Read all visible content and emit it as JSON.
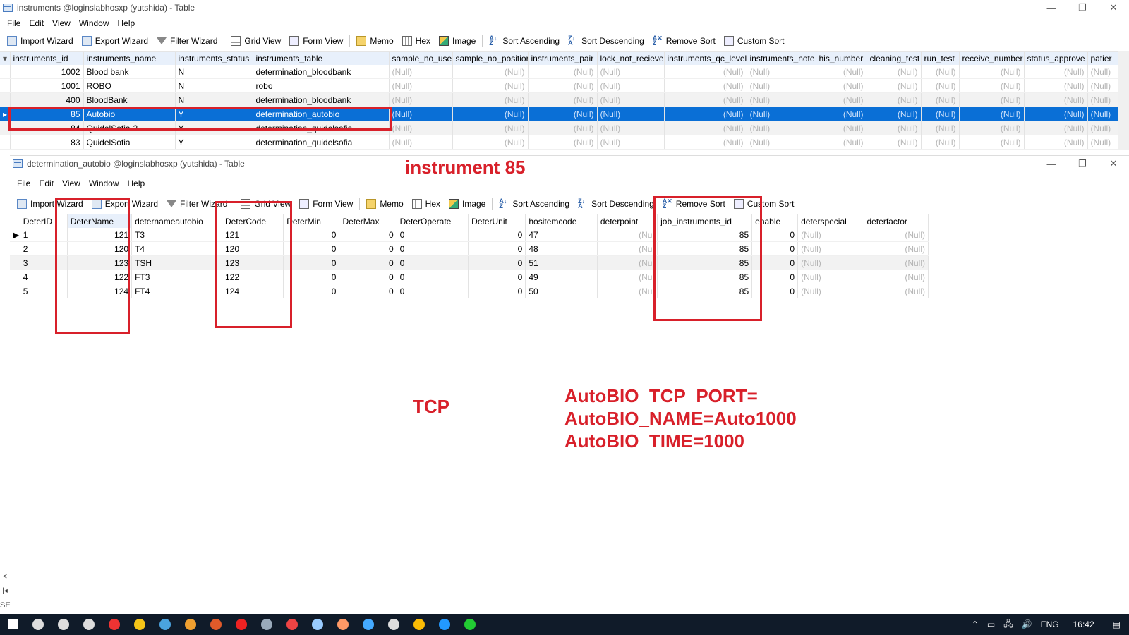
{
  "top_window": {
    "title": "instruments @loginslabhosxp (yutshida) - Table",
    "controls": [
      "—",
      "❐",
      "✕"
    ],
    "menu": [
      "File",
      "Edit",
      "View",
      "Window",
      "Help"
    ],
    "toolbar": {
      "import_wizard": "Import Wizard",
      "export_wizard": "Export Wizard",
      "filter_wizard": "Filter Wizard",
      "grid_view": "Grid View",
      "form_view": "Form View",
      "memo": "Memo",
      "hex": "Hex",
      "image": "Image",
      "sort_asc": "Sort Ascending",
      "sort_desc": "Sort Descending",
      "remove_sort": "Remove Sort",
      "custom_sort": "Custom Sort"
    },
    "columns": [
      "instruments_id",
      "instruments_name",
      "instruments_status",
      "instruments_table",
      "sample_no_use",
      "sample_no_positior",
      "instruments_pair",
      "lock_not_recieve",
      "instruments_qc_level",
      "instruments_note",
      "his_number",
      "cleaning_test",
      "run_test",
      "receive_number",
      "status_approve",
      "patier"
    ],
    "rows": [
      [
        "1002",
        "Blood bank",
        "N",
        "determination_bloodbank"
      ],
      [
        "1001",
        "ROBO",
        "N",
        "robo"
      ],
      [
        "400",
        "BloodBank",
        "N",
        "determination_bloodbank"
      ],
      [
        "85",
        "Autobio",
        "Y",
        "determination_autobio"
      ],
      [
        "84",
        "QuidelSofia-2",
        "Y",
        "determination_quidelsofia"
      ],
      [
        "83",
        "QuidelSofia",
        "Y",
        "determination_quidelsofia"
      ]
    ],
    "null_text": "(Null)"
  },
  "bottom_window": {
    "title": "determination_autobio @loginslabhosxp (yutshida) - Table",
    "controls": [
      "—",
      "❐",
      "✕"
    ],
    "menu": [
      "File",
      "Edit",
      "View",
      "Window",
      "Help"
    ],
    "toolbar": {
      "import_wizard": "Import Wizard",
      "export_wizard": "Export Wizard",
      "filter_wizard": "Filter Wizard",
      "grid_view": "Grid View",
      "form_view": "Form View",
      "memo": "Memo",
      "hex": "Hex",
      "image": "Image",
      "sort_asc": "Sort Ascending",
      "sort_desc": "Sort Descending",
      "remove_sort": "Remove Sort",
      "custom_sort": "Custom Sort"
    },
    "columns": [
      "DeterID",
      "DeterName",
      "deternameautobio",
      "DeterCode",
      "DeterMin",
      "DeterMax",
      "DeterOperate",
      "DeterUnit",
      "hositemcode",
      "deterpoint",
      "job_instruments_id",
      "enable",
      "deterspecial",
      "deterfactor"
    ],
    "rows": [
      [
        "1",
        "121",
        "T3",
        "121",
        "0",
        "0",
        "0",
        "0",
        "47",
        "(Nul",
        "85",
        "0",
        "(Null)",
        "(Null)"
      ],
      [
        "2",
        "120",
        "T4",
        "120",
        "0",
        "0",
        "0",
        "0",
        "48",
        "(Nul",
        "85",
        "0",
        "(Null)",
        "(Null)"
      ],
      [
        "3",
        "123",
        "TSH",
        "123",
        "0",
        "0",
        "0",
        "0",
        "51",
        "(Nul",
        "85",
        "0",
        "(Null)",
        "(Null)"
      ],
      [
        "4",
        "122",
        "FT3",
        "122",
        "0",
        "0",
        "0",
        "0",
        "49",
        "(Nul",
        "85",
        "0",
        "(Null)",
        "(Null)"
      ],
      [
        "5",
        "124",
        "FT4",
        "124",
        "0",
        "0",
        "0",
        "0",
        "50",
        "(Nul",
        "85",
        "0",
        "(Null)",
        "(Null)"
      ]
    ]
  },
  "annotations": {
    "instrument": "instrument 85",
    "tcp": "TCP",
    "cfg1": "AutoBIO_TCP_PORT=",
    "cfg2": "AutoBIO_NAME=Auto1000",
    "cfg3": "AutoBIO_TIME=1000",
    "accent": "#d8202a"
  },
  "statusbar": {
    "left": "SE"
  },
  "taskbar": {
    "lang": "ENG",
    "time": "16:42",
    "icons": [
      "start-icon",
      "search-icon",
      "cortana-icon",
      "task-view-icon",
      "app-icon",
      "app-icon",
      "app-icon",
      "app-icon",
      "app-icon",
      "app-icon",
      "calculator-icon",
      "app-icon",
      "app-icon",
      "app-icon",
      "app-icon",
      "app-icon",
      "chrome-icon",
      "app-icon",
      "line-icon"
    ]
  }
}
